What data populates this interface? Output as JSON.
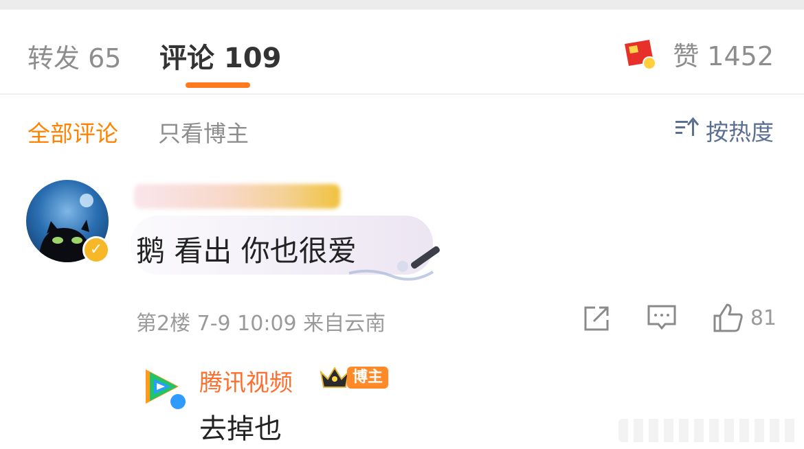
{
  "tabs": {
    "repost": "转发 65",
    "comment": "评论 109",
    "like": "赞 1452"
  },
  "filters": {
    "all": "全部评论",
    "blogger_only": "只看博主",
    "sort": "按热度"
  },
  "comment": {
    "text": "鹅 看出 你也很爱",
    "meta": "第2楼  7-9 10:09  来自云南",
    "like_count": "81",
    "icons": [
      "share-icon",
      "comment-icon",
      "thumbs-up-icon"
    ]
  },
  "reply": {
    "author": "腾讯视频",
    "badge": "博主",
    "text": "去掉也"
  },
  "colors": {
    "accent": "#ff8200",
    "tab_underline": "#ff7a1c",
    "sort_blue": "#5b6f93",
    "reply_name": "#ff6e2c"
  }
}
